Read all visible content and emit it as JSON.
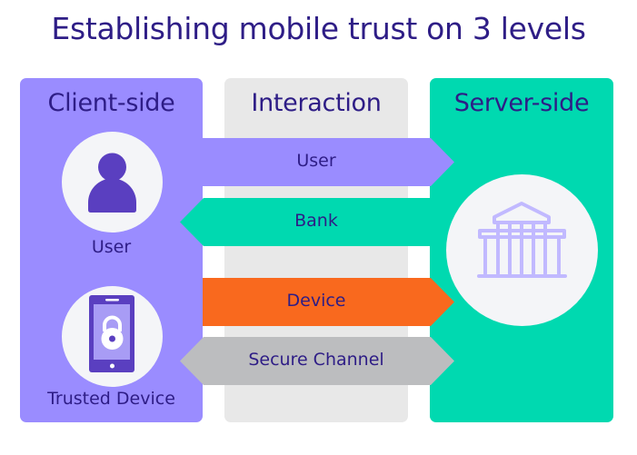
{
  "title": "Establishing mobile trust on 3 levels",
  "columns": {
    "client": {
      "heading": "Client-side",
      "items": [
        {
          "label": "User",
          "icon": "user-icon"
        },
        {
          "label": "Trusted Device",
          "icon": "locked-phone-icon"
        }
      ]
    },
    "interaction": {
      "heading": "Interaction"
    },
    "server": {
      "heading": "Server-side",
      "items": [
        {
          "label": "",
          "icon": "bank-icon"
        }
      ]
    }
  },
  "arrows": [
    {
      "label": "User",
      "direction": "right",
      "color": "#9a8cff"
    },
    {
      "label": "Bank",
      "direction": "left",
      "color": "#00d9b0"
    },
    {
      "label": "Device",
      "direction": "right",
      "color": "#f9691e"
    },
    {
      "label": "Secure Channel",
      "direction": "both",
      "color": "#bcbdbf"
    }
  ],
  "colors": {
    "client": "#9a8cff",
    "interaction": "#e8e8e8",
    "server": "#00d9b0",
    "text": "#2e1d86",
    "icon_dark": "#5a3fc0",
    "icon_light": "#c1b9ff"
  }
}
